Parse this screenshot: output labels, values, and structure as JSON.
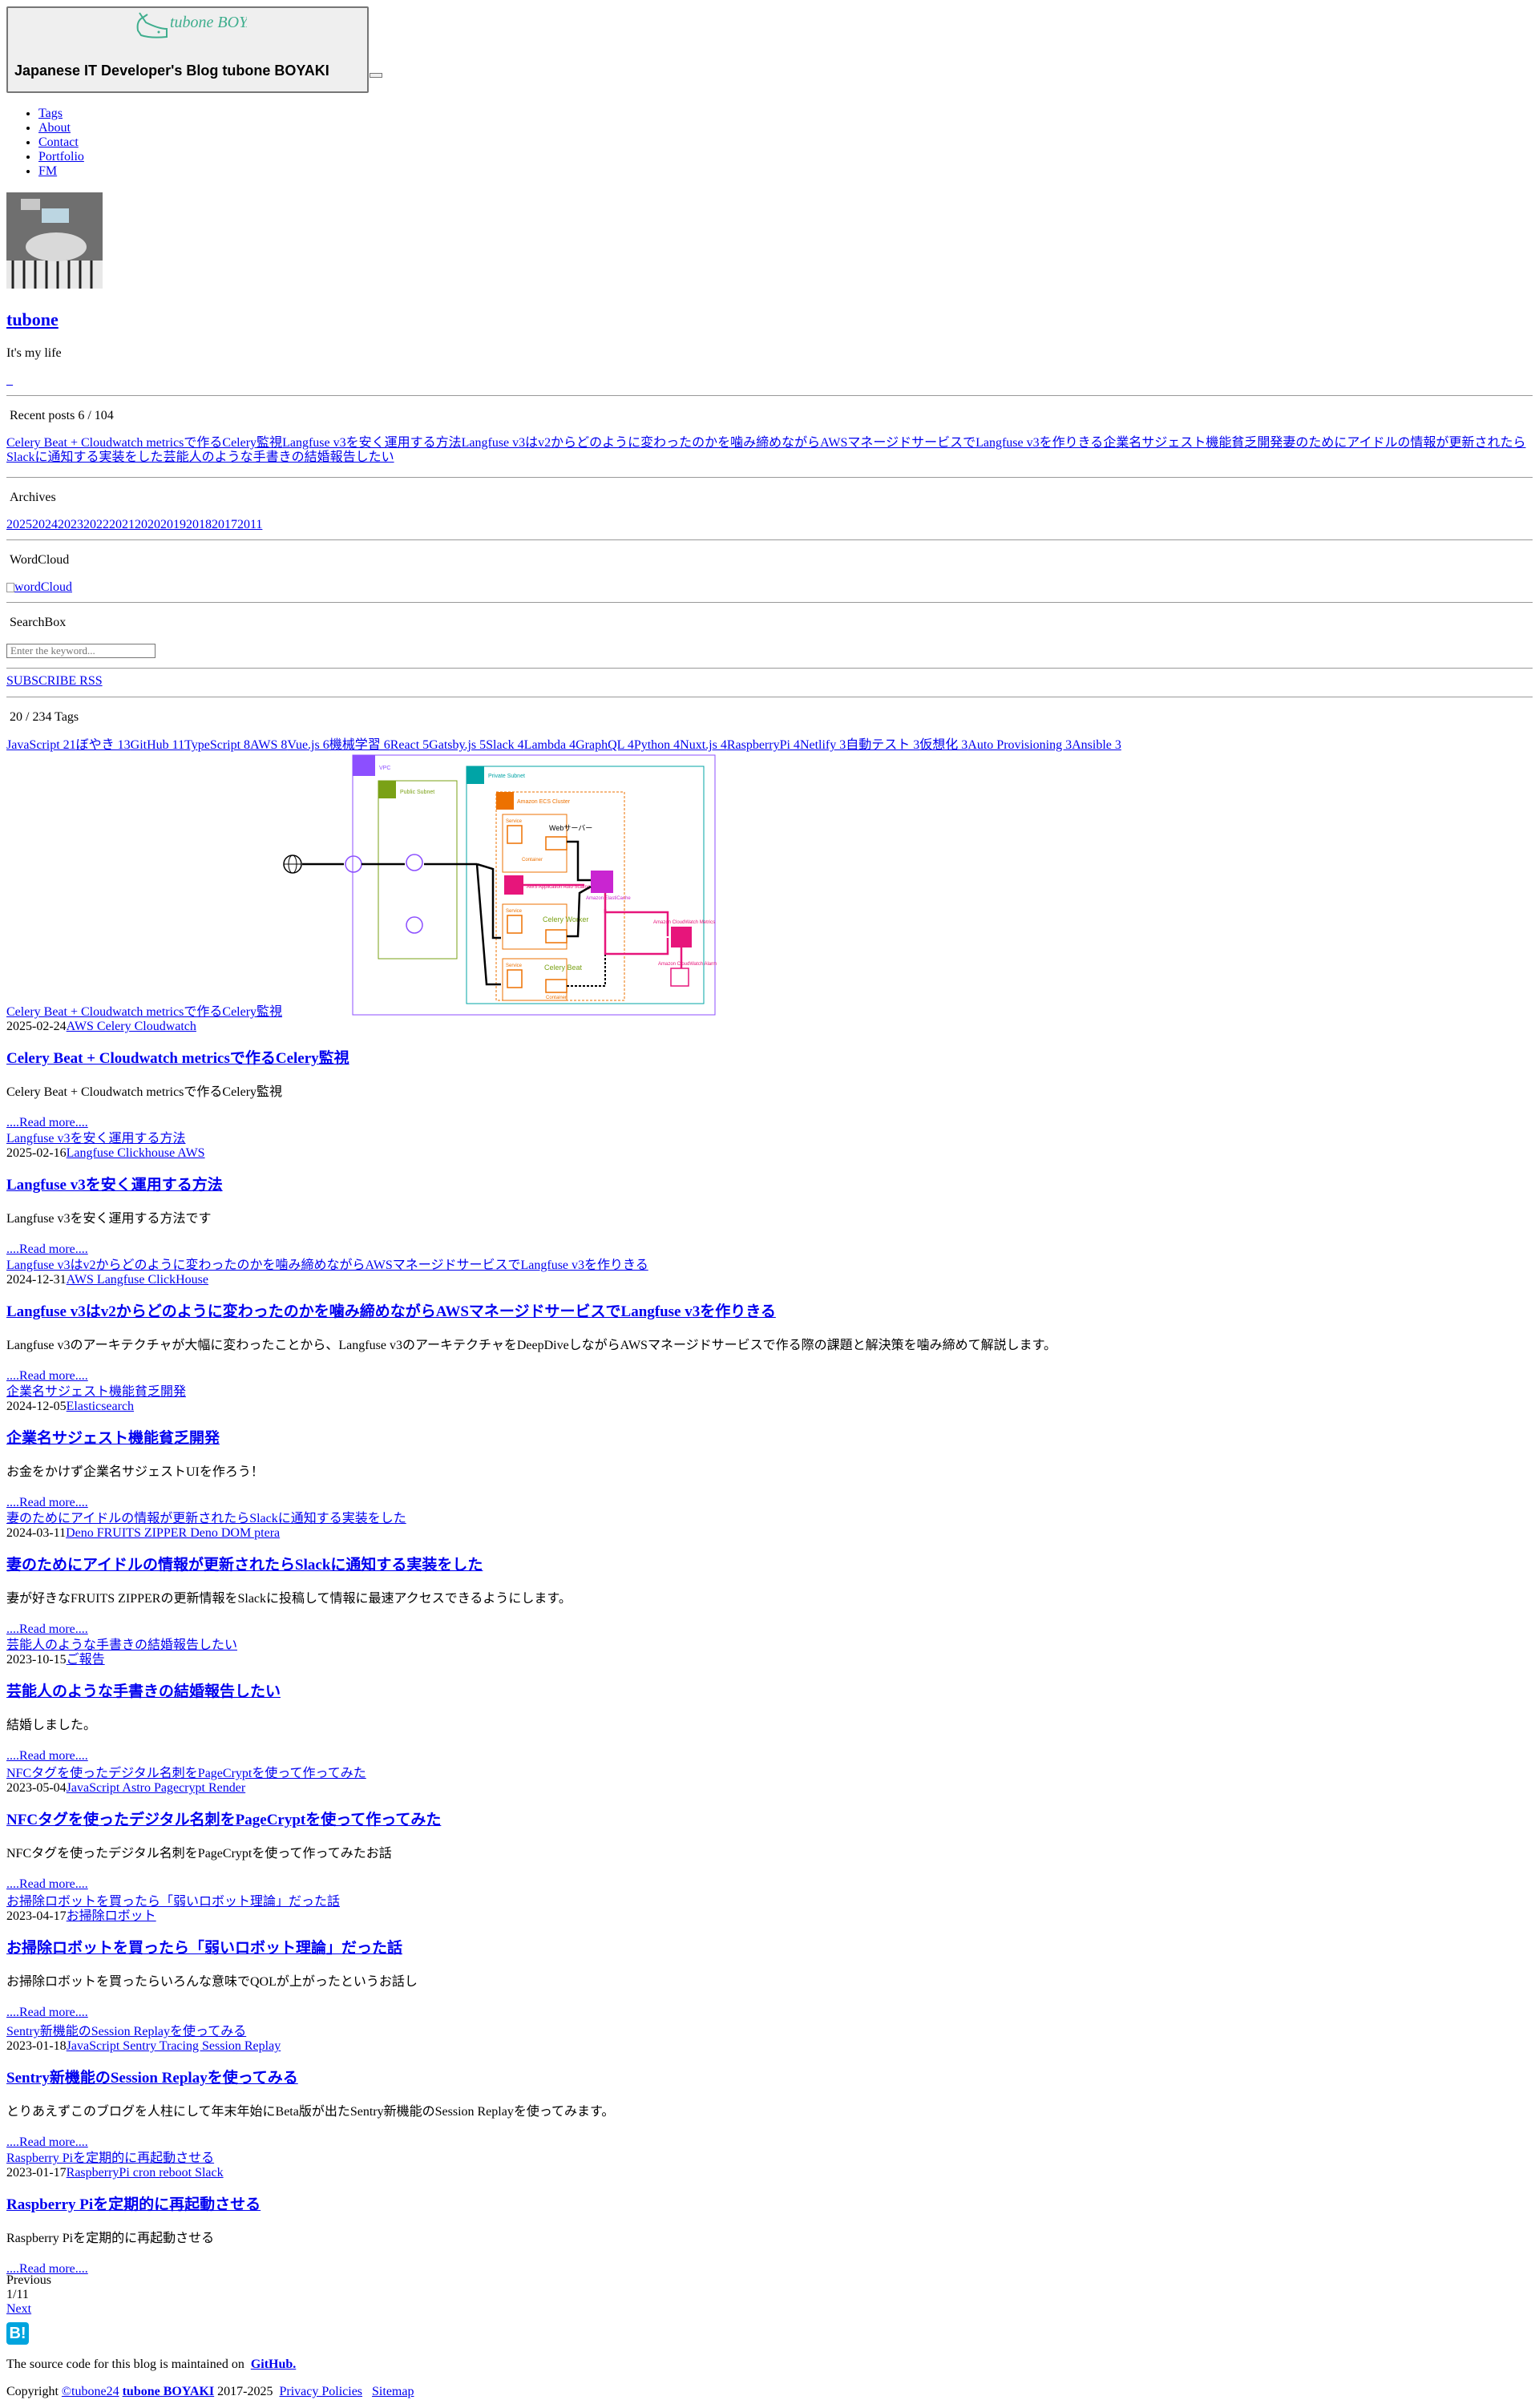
{
  "header": {
    "logo_text": "tubone BOYAKI",
    "brand": "Japanese IT Developer's Blog tubone BOYAKI",
    "nav": [
      "Tags",
      "About",
      "Contact",
      "Portfolio",
      "FM"
    ]
  },
  "profile": {
    "name": "tubone",
    "tagline": "It's my life",
    "link": "_"
  },
  "recent": {
    "title": "Recent posts  6 / 104",
    "items": [
      "Celery Beat + Cloudwatch metricsで作るCelery監視",
      "Langfuse v3を安く運用する方法",
      "Langfuse v3はv2からどのように変わったのかを噛み締めながらAWSマネージドサービスでLangfuse v3を作りきる",
      "企業名サジェスト機能貧乏開発",
      "妻のためにアイドルの情報が更新されたらSlackに通知する実装をした",
      "芸能人のような手書きの結婚報告したい"
    ]
  },
  "archives": {
    "title": "Archives",
    "years": [
      "2025",
      "2024",
      "2023",
      "2022",
      "2021",
      "2020",
      "2019",
      "2018",
      "2017",
      "2011"
    ]
  },
  "wordcloud": {
    "title": "WordCloud",
    "alt": "wordCloud"
  },
  "searchbox": {
    "title": "SearchBox",
    "placeholder": "Enter the keyword..."
  },
  "subscribe": "SUBSCRIBE RSS",
  "tags": {
    "title": "20 / 234 Tags",
    "items": [
      "JavaScript 21",
      "ぼやき 13",
      "GitHub 11",
      "TypeScript 8",
      "AWS 8",
      "Vue.js 6",
      "機械学習 6",
      "React 5",
      "Gatsby.js 5",
      "Slack 4",
      "Lambda 4",
      "GraphQL 4",
      "Python 4",
      "Nuxt.js 4",
      "RaspberryPi 4",
      "Netlify 3",
      "自動テスト 3",
      "仮想化 3",
      "Auto Provisioning 3",
      "Ansible 3"
    ]
  },
  "diagram": {
    "vpc": "VPC",
    "public_subnet": "Public Subnet",
    "private_subnet": "Private Subnet",
    "ecs_cluster": "Amazon ECS Cluster",
    "service": "Service",
    "container": "Container",
    "web_server": "Webサーバー",
    "autoscaling": "AWS Application Auto Scaling",
    "elasticache": "Amazon ElastiCache",
    "celery_worker": "Celery Worker",
    "celery_beat": "Celery Beat",
    "cw_metrics": "Amazon CloudWatch Metrics",
    "cw_alarm": "Amazon CloudWatch Alarm"
  },
  "posts": [
    {
      "link": "Celery Beat + Cloudwatch metricsで作るCelery監視",
      "date": "2025-02-24",
      "tags": "AWS Celery Cloudwatch",
      "title": "Celery Beat + Cloudwatch metricsで作るCelery監視",
      "excerpt": "Celery Beat + Cloudwatch metricsで作るCelery監視",
      "more": "....Read more...."
    },
    {
      "link": "Langfuse v3を安く運用する方法",
      "date": "2025-02-16",
      "tags": "Langfuse Clickhouse AWS",
      "title": "Langfuse v3を安く運用する方法",
      "excerpt": "Langfuse v3を安く運用する方法です",
      "more": "....Read more...."
    },
    {
      "link": "Langfuse v3はv2からどのように変わったのかを噛み締めながらAWSマネージドサービスでLangfuse v3を作りきる",
      "date": "2024-12-31",
      "tags": "AWS Langfuse ClickHouse",
      "title": "Langfuse v3はv2からどのように変わったのかを噛み締めながらAWSマネージドサービスでLangfuse v3を作りきる",
      "excerpt": "Langfuse v3のアーキテクチャが大幅に変わったことから、Langfuse v3のアーキテクチャをDeepDiveしながらAWSマネージドサービスで作る際の課題と解決策を噛み締めて解説します。",
      "more": "....Read more...."
    },
    {
      "link": "企業名サジェスト機能貧乏開発",
      "date": "2024-12-05",
      "tags": "Elasticsearch",
      "title": "企業名サジェスト機能貧乏開発",
      "excerpt": "お金をかけず企業名サジェストUIを作ろう！",
      "more": "....Read more...."
    },
    {
      "link": "妻のためにアイドルの情報が更新されたらSlackに通知する実装をした",
      "date": "2024-03-11",
      "tags": "Deno FRUITS ZIPPER Deno DOM ptera",
      "title": "妻のためにアイドルの情報が更新されたらSlackに通知する実装をした",
      "excerpt": "妻が好きなFRUITS ZIPPERの更新情報をSlackに投稿して情報に最速アクセスできるようにします。",
      "more": "....Read more...."
    },
    {
      "link": "芸能人のような手書きの結婚報告したい",
      "date": "2023-10-15",
      "tags": "ご報告",
      "title": "芸能人のような手書きの結婚報告したい",
      "excerpt": "結婚しました。",
      "more": "....Read more...."
    },
    {
      "link": "NFCタグを使ったデジタル名刺をPageCryptを使って作ってみた",
      "date": "2023-05-04",
      "tags": "JavaScript Astro Pagecrypt Render",
      "title": "NFCタグを使ったデジタル名刺をPageCryptを使って作ってみた",
      "excerpt": "NFCタグを使ったデジタル名刺をPageCryptを使って作ってみたお話",
      "more": "....Read more...."
    },
    {
      "link": "お掃除ロボットを買ったら「弱いロボット理論」だった話",
      "date": "2023-04-17",
      "tags": "お掃除ロボット",
      "title": "お掃除ロボットを買ったら「弱いロボット理論」だった話",
      "excerpt": "お掃除ロボットを買ったらいろんな意味でQOLが上がったというお話し",
      "more": "....Read more...."
    },
    {
      "link": "Sentry新機能のSession Replayを使ってみる",
      "date": "2023-01-18",
      "tags": "JavaScript Sentry Tracing Session Replay",
      "title": "Sentry新機能のSession Replayを使ってみる",
      "excerpt": "とりあえずこのブログを人柱にして年末年始にBeta版が出たSentry新機能のSession Replayを使ってみます。",
      "more": "....Read more...."
    },
    {
      "link": "Raspberry Piを定期的に再起動させる",
      "date": "2023-01-17",
      "tags": "RaspberryPi cron reboot Slack",
      "title": "Raspberry Piを定期的に再起動させる",
      "excerpt": "Raspberry Piを定期的に再起動させる",
      "more": "....Read more...."
    }
  ],
  "pagination": {
    "previous": "Previous",
    "page": "1/11",
    "next": "Next"
  },
  "footer": {
    "hatena": "B!",
    "source_text": "The source code for this blog is maintained on",
    "github": "GitHub.",
    "copyright": "Copyright",
    "author": "©tubone24",
    "site": "tubone BOYAKI",
    "years": "2017-2025",
    "privacy": "Privacy Policies",
    "sitemap": "Sitemap"
  },
  "colors": {
    "link": "#0000ee",
    "logo": "#3fae8e",
    "aws_purple": "#8c4fff",
    "aws_green": "#7aa116",
    "aws_orange": "#ed7100",
    "aws_pink": "#e7157b",
    "aws_teal": "#00a4a6"
  }
}
